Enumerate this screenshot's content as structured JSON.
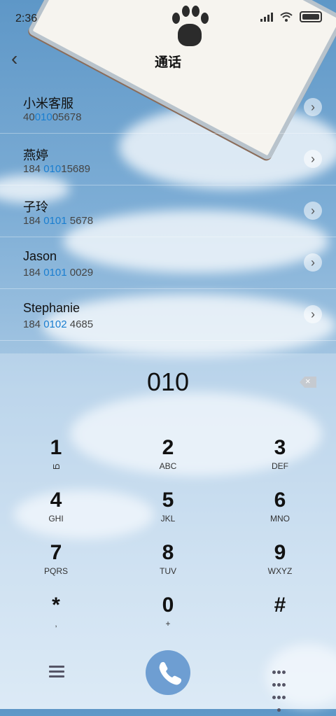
{
  "status_bar": {
    "time": "2:36"
  },
  "header": {
    "title": "通话"
  },
  "contacts": [
    {
      "name": "小米客服",
      "num_pre": "40",
      "num_hl": "010",
      "num_post": "05678"
    },
    {
      "name": "燕婷",
      "num_pre": "184 ",
      "num_hl": "010",
      "num_post": "15689"
    },
    {
      "name": "子玲",
      "num_pre": "184 ",
      "num_hl": "0101",
      "num_post": " 5678"
    },
    {
      "name": "Jason",
      "num_pre": "184 ",
      "num_hl": "0101",
      "num_post": " 0029"
    },
    {
      "name": "Stephanie",
      "num_pre": "184 ",
      "num_hl": "0102",
      "num_post": " 4685"
    }
  ],
  "dialpad": {
    "input": "010",
    "keys": [
      {
        "d": "1",
        "s": "ഥ"
      },
      {
        "d": "2",
        "s": "ABC"
      },
      {
        "d": "3",
        "s": "DEF"
      },
      {
        "d": "4",
        "s": "GHI"
      },
      {
        "d": "5",
        "s": "JKL"
      },
      {
        "d": "6",
        "s": "MNO"
      },
      {
        "d": "7",
        "s": "PQRS"
      },
      {
        "d": "8",
        "s": "TUV"
      },
      {
        "d": "9",
        "s": "WXYZ"
      },
      {
        "d": "*",
        "s": ","
      },
      {
        "d": "0",
        "s": "+"
      },
      {
        "d": "#",
        "s": ""
      }
    ]
  },
  "icons": [
    "back-icon",
    "chevron-right-icon",
    "backspace-icon",
    "menu-icon",
    "phone-icon",
    "dialpad-grid-icon",
    "signal-icon",
    "wifi-icon",
    "battery-icon",
    "paw-icon"
  ],
  "colors": {
    "accent": "#1a7ed0",
    "call_button": "#6e9ed2"
  }
}
